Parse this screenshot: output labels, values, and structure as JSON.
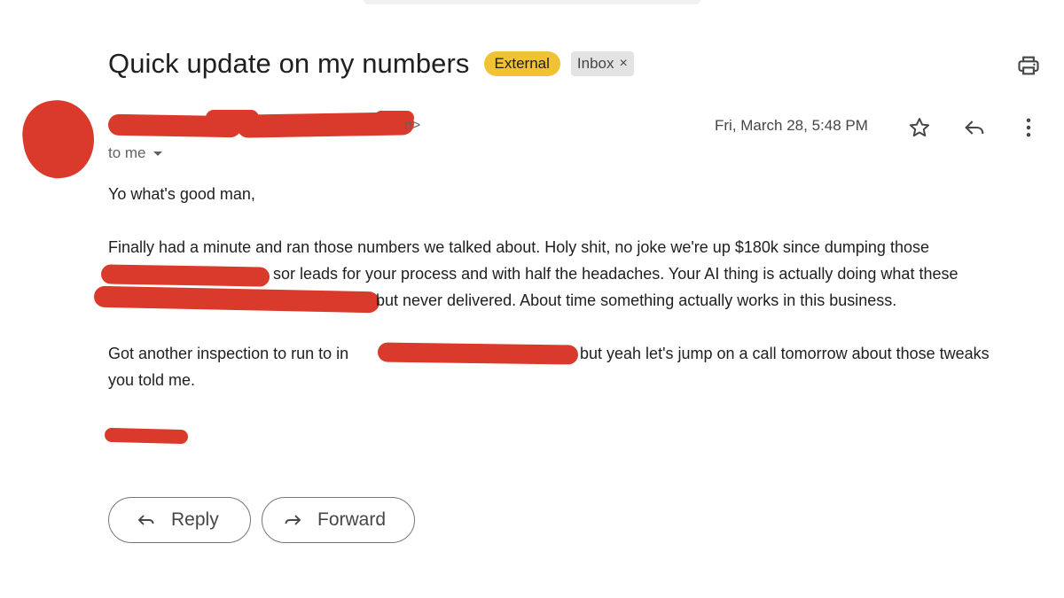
{
  "email": {
    "subject": "Quick update on my numbers",
    "labels": {
      "external": "External",
      "inbox": "Inbox",
      "remove_label": "×"
    },
    "sender_tail": "n>",
    "to_me": "to me",
    "date": "Fri, March 28, 5:48 PM",
    "body": {
      "greeting": "Yo what's good man,",
      "p2_line1": "Finally had a minute and ran those numbers we talked about. Holy shit, no joke we're up $180k since dumping those",
      "p2_line2_visible": "sor leads for your process and with half the headaches. Your AI thing is actually doing what these",
      "p2_line3_visible": "but never delivered. About time something actually works in this business.",
      "p3_line1_start": "Got another inspection to run to in",
      "p3_line1_end": "but yeah let's jump on a call tomorrow about those tweaks",
      "p3_line2": "you told me."
    }
  },
  "actions": {
    "reply": "Reply",
    "forward": "Forward"
  },
  "icons": {
    "print": "print-icon",
    "star": "star-icon",
    "reply": "reply-icon",
    "more": "more-vert-icon",
    "forward": "forward-icon"
  },
  "colors": {
    "external_badge": "#f1c232",
    "inbox_badge": "#e3e3e3",
    "redaction": "#d93a2b",
    "text": "#1f1f1f",
    "muted": "#5f6368"
  }
}
